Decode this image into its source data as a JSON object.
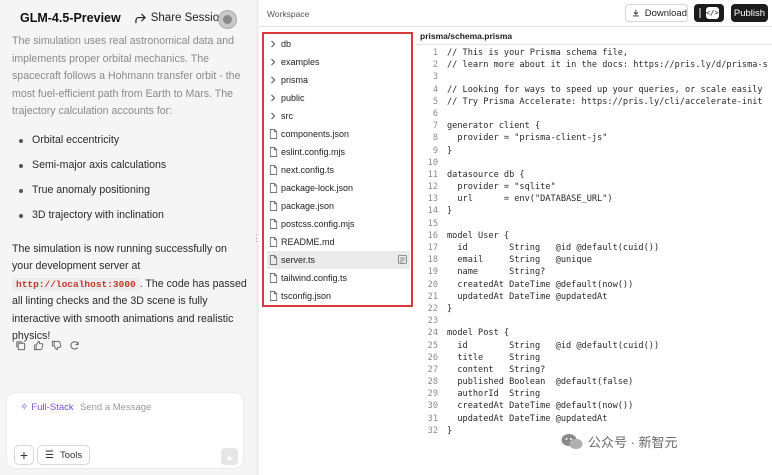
{
  "chat": {
    "model_name": "GLM-4.5-Preview",
    "share_label": "Share Session",
    "messages": {
      "para1": "The simulation uses real astronomical data and implements proper orbital mechanics. The spacecraft follows a Hohmann transfer orbit - the most fuel-efficient path from Earth to Mars. The trajectory calculation accounts for:",
      "bullets": [
        "Orbital eccentricity",
        "Semi-major axis calculations",
        "True anomaly positioning",
        "3D trajectory with inclination"
      ],
      "para2_pre": "The simulation is now running successfully on your development server at ",
      "url": "http://localhost:3000",
      "para2_post": ". The code has passed all linting checks and the 3D scene is fully interactive with smooth animations and realistic physics!"
    },
    "input": {
      "mode_label": "Full-Stack",
      "placeholder": "Send a Message",
      "tools_label": "Tools"
    }
  },
  "workspace": {
    "label": "Workspace",
    "download_label": "Download",
    "publish_label": "Publish",
    "file_tree": [
      {
        "name": "db",
        "type": "folder"
      },
      {
        "name": "examples",
        "type": "folder"
      },
      {
        "name": "prisma",
        "type": "folder"
      },
      {
        "name": "public",
        "type": "folder"
      },
      {
        "name": "src",
        "type": "folder"
      },
      {
        "name": "components.json",
        "type": "file"
      },
      {
        "name": "eslint.config.mjs",
        "type": "file"
      },
      {
        "name": "next.config.ts",
        "type": "file"
      },
      {
        "name": "package-lock.json",
        "type": "file"
      },
      {
        "name": "package.json",
        "type": "file"
      },
      {
        "name": "postcss.config.mjs",
        "type": "file"
      },
      {
        "name": "README.md",
        "type": "file"
      },
      {
        "name": "server.ts",
        "type": "file",
        "selected": true
      },
      {
        "name": "tailwind.config.ts",
        "type": "file"
      },
      {
        "name": "tsconfig.json",
        "type": "file"
      }
    ],
    "editor": {
      "tab_title": "prisma/schema.prisma",
      "lines": [
        "// This is your Prisma schema file,",
        "// learn more about it in the docs: https://pris.ly/d/prisma-s",
        "",
        "// Looking for ways to speed up your queries, or scale easily",
        "// Try Prisma Accelerate: https://pris.ly/cli/accelerate-init",
        "",
        "generator client {",
        "  provider = \"prisma-client-js\"",
        "}",
        "",
        "datasource db {",
        "  provider = \"sqlite\"",
        "  url      = env(\"DATABASE_URL\")",
        "}",
        "",
        "model User {",
        "  id        String   @id @default(cuid())",
        "  email     String   @unique",
        "  name      String?",
        "  createdAt DateTime @default(now())",
        "  updatedAt DateTime @updatedAt",
        "}",
        "",
        "model Post {",
        "  id        String   @id @default(cuid())",
        "  title     String",
        "  content   String?",
        "  published Boolean  @default(false)",
        "  authorId  String",
        "  createdAt DateTime @default(now())",
        "  updatedAt DateTime @updatedAt",
        "}"
      ]
    }
  },
  "watermark": "公众号 · 新智元",
  "colors": {
    "highlight_border": "#d83a3a",
    "accent_purple": "#7b4fe0",
    "url_red": "#c0392b",
    "dark_button": "#1c1c1c"
  }
}
